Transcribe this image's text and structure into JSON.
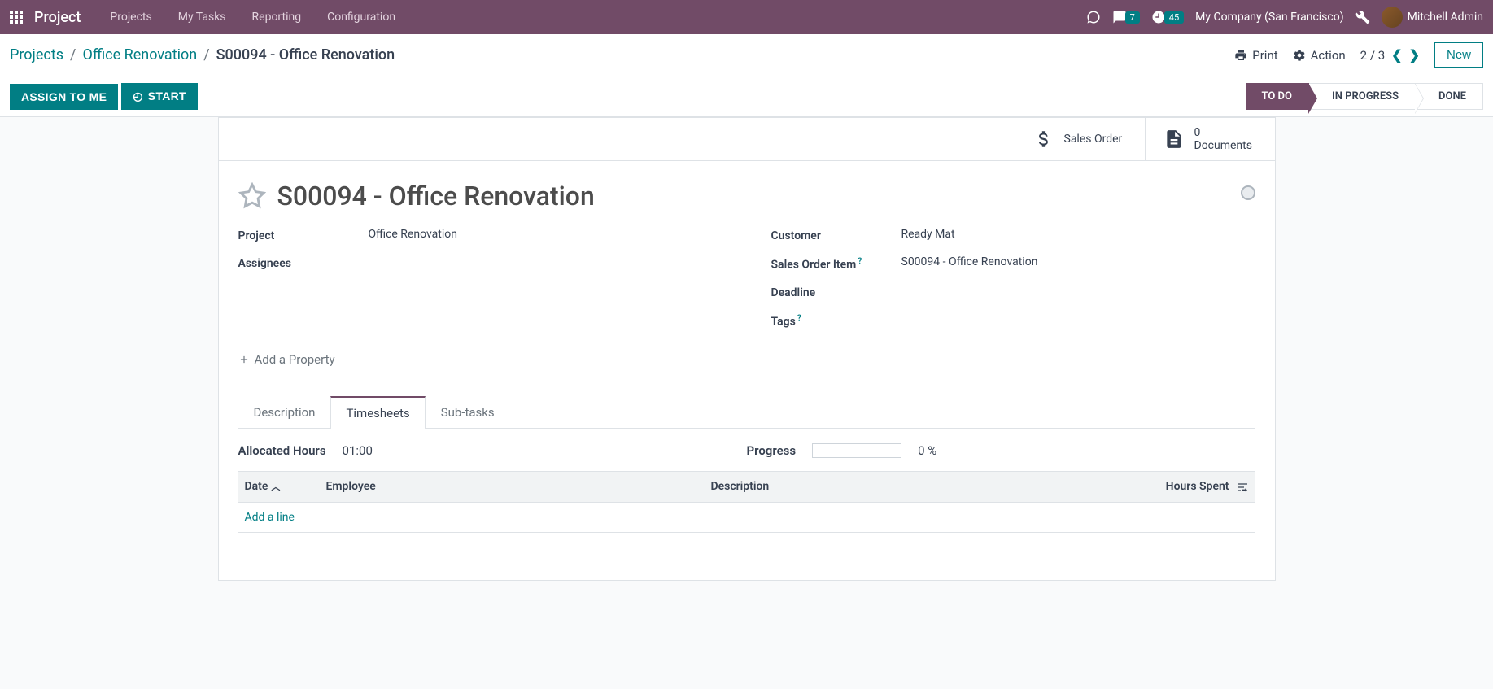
{
  "navbar": {
    "app_title": "Project",
    "menu": [
      "Projects",
      "My Tasks",
      "Reporting",
      "Configuration"
    ],
    "messages_badge": "7",
    "activities_badge": "45",
    "company": "My Company (San Francisco)",
    "user": "Mitchell Admin"
  },
  "breadcrumb": {
    "links": [
      "Projects",
      "Office Renovation"
    ],
    "current": "S00094 - Office Renovation"
  },
  "cp": {
    "print": "Print",
    "action": "Action",
    "pager": "2 / 3",
    "new": "New"
  },
  "statusbar": {
    "assign": "ASSIGN TO ME",
    "start": "START",
    "stages": [
      "TO DO",
      "IN PROGRESS",
      "DONE"
    ],
    "active_stage": 0
  },
  "statbox": {
    "sales_order": "Sales Order",
    "doc_count": "0",
    "doc_label": "Documents"
  },
  "task": {
    "title": "S00094 - Office Renovation",
    "fields_left": {
      "project_label": "Project",
      "project_value": "Office Renovation",
      "assignees_label": "Assignees",
      "assignees_value": ""
    },
    "fields_right": {
      "customer_label": "Customer",
      "customer_value": "Ready Mat",
      "soi_label": "Sales Order Item",
      "soi_value": "S00094 - Office Renovation",
      "deadline_label": "Deadline",
      "deadline_value": "",
      "tags_label": "Tags",
      "tags_value": ""
    },
    "add_property": "Add a Property"
  },
  "tabs": {
    "items": [
      "Description",
      "Timesheets",
      "Sub-tasks"
    ],
    "active": 1
  },
  "timesheets": {
    "allocated_label": "Allocated Hours",
    "allocated_value": "01:00",
    "progress_label": "Progress",
    "progress_pct": "0 %",
    "columns": {
      "date": "Date",
      "employee": "Employee",
      "description": "Description",
      "hours": "Hours Spent"
    },
    "add_line": "Add a line"
  }
}
